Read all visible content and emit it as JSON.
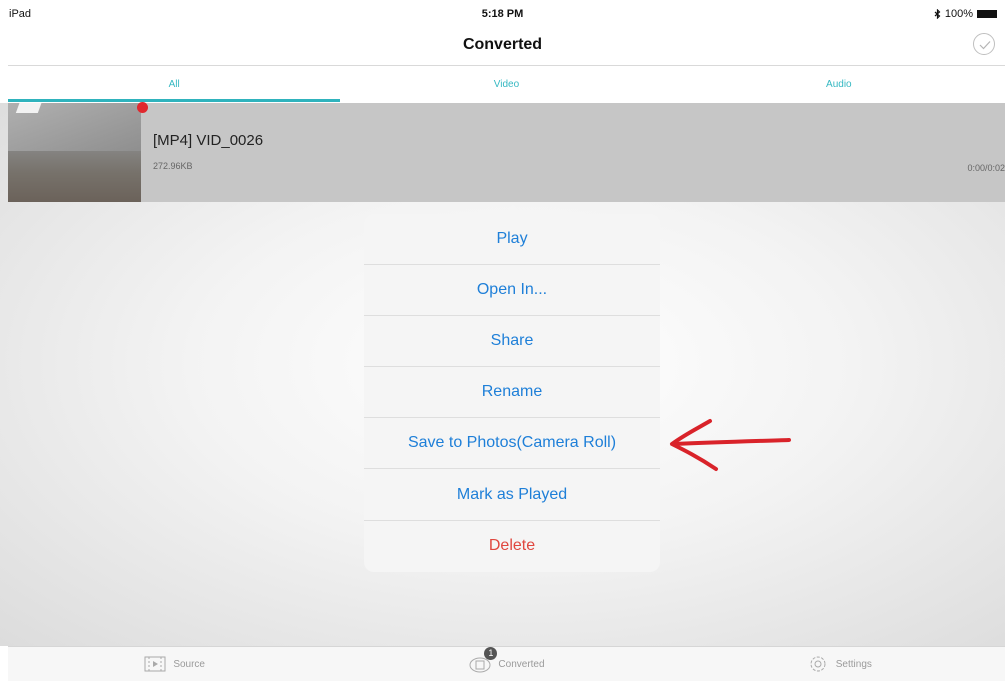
{
  "status_bar": {
    "device": "iPad",
    "time": "5:18 PM",
    "battery": "100%"
  },
  "nav": {
    "title": "Converted"
  },
  "tabs": [
    {
      "label": "All",
      "active": true
    },
    {
      "label": "Video",
      "active": false
    },
    {
      "label": "Audio",
      "active": false
    }
  ],
  "file": {
    "name": "[MP4] VID_0026",
    "size": "272.96KB",
    "duration": "0:00/0:02"
  },
  "actions": [
    {
      "label": "Play"
    },
    {
      "label": "Open In..."
    },
    {
      "label": "Share"
    },
    {
      "label": "Rename"
    },
    {
      "label": "Save to Photos(Camera Roll)"
    },
    {
      "label": "Mark as Played"
    },
    {
      "label": "Delete",
      "destructive": true
    }
  ],
  "tab_bar": {
    "items": [
      {
        "label": "Source",
        "icon": "source-icon"
      },
      {
        "label": "Converted",
        "icon": "converted-icon",
        "badge": "1"
      },
      {
        "label": "Settings",
        "icon": "gear-icon"
      }
    ]
  },
  "colors": {
    "accent": "#2fb3bd",
    "action_blue": "#1e7fd8",
    "destructive_red": "#e0473f",
    "annotation_red": "#d9232a"
  }
}
